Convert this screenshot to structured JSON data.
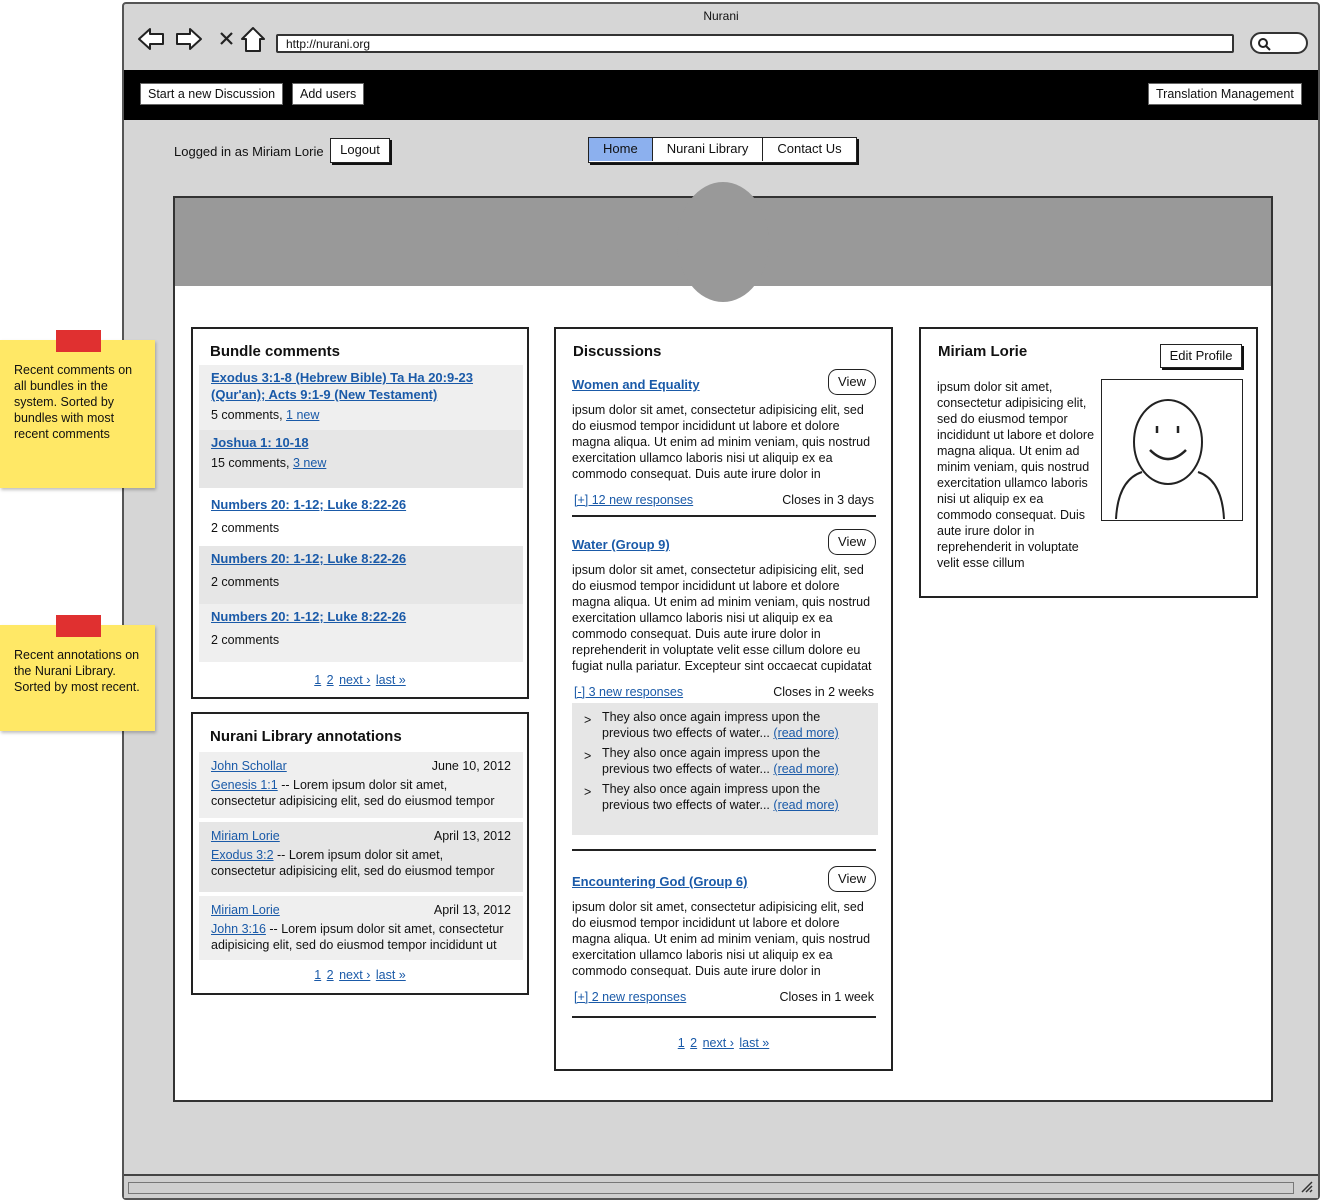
{
  "window": {
    "title": "Nurani",
    "url": "http://nurani.org"
  },
  "toolbar": {
    "start_discussion": "Start a new Discussion",
    "add_users": "Add users",
    "translation_management": "Translation Management"
  },
  "session": {
    "logged_in_text": "Logged in as Miriam Lorie",
    "logout": "Logout"
  },
  "nav": {
    "tabs": [
      {
        "label": "Home",
        "active": true
      },
      {
        "label": "Nurani Library",
        "active": false
      },
      {
        "label": "Contact Us",
        "active": false
      }
    ]
  },
  "bundle_comments": {
    "title": "Bundle comments",
    "items": [
      {
        "title": "Exodus 3:1-8 (Hebrew Bible) Ta Ha 20:9-23 (Qur'an); Acts 9:1-9 (New Testament)",
        "meta": "5 comments, ",
        "new": "1 new"
      },
      {
        "title": "Joshua 1: 10-18",
        "meta": "15 comments, ",
        "new": "3 new"
      },
      {
        "title": "Numbers 20: 1-12; Luke 8:22-26",
        "meta": "2 comments",
        "new": ""
      },
      {
        "title": "Numbers 20: 1-12; Luke 8:22-26",
        "meta": "2 comments",
        "new": ""
      },
      {
        "title": "Numbers 20: 1-12; Luke 8:22-26",
        "meta": "2 comments",
        "new": ""
      }
    ],
    "pager": {
      "p1": "1",
      "p2": "2",
      "next": "next ›",
      "last": "last »"
    }
  },
  "annotations": {
    "title": "Nurani Library annotations",
    "items": [
      {
        "user": "John Schollar",
        "date": "June 10, 2012",
        "ref": "Genesis 1:1",
        "text": " -- Lorem ipsum dolor sit amet, consectetur adipisicing elit, sed do eiusmod tempor"
      },
      {
        "user": "Miriam Lorie",
        "date": "April 13, 2012",
        "ref": "Exodus 3:2",
        "text": " -- Lorem ipsum dolor sit amet, consectetur adipisicing elit, sed do eiusmod tempor"
      },
      {
        "user": "Miriam Lorie",
        "date": "April 13, 2012",
        "ref": "John 3:16",
        "text": " -- Lorem ipsum dolor sit amet, consectetur adipisicing elit, sed do eiusmod tempor incididunt ut"
      }
    ],
    "pager": {
      "p1": "1",
      "p2": "2",
      "next": "next ›",
      "last": "last »"
    }
  },
  "discussions": {
    "title": "Discussions",
    "view_label": "View",
    "items": [
      {
        "title": "Women and Equality",
        "body": "ipsum dolor sit amet, consectetur adipisicing elit, sed do eiusmod tempor incididunt ut labore et dolore magna aliqua. Ut enim ad minim veniam, quis nostrud exercitation ullamco laboris nisi ut aliquip ex ea commodo consequat. Duis aute irure dolor in",
        "responses": "[+] 12 new responses",
        "closes": "Closes in 3 days"
      },
      {
        "title": "Water (Group 9)",
        "body": "ipsum dolor sit amet, consectetur adipisicing elit, sed do eiusmod tempor incididunt ut labore et dolore magna aliqua. Ut enim ad minim veniam, quis nostrud exercitation ullamco laboris nisi ut aliquip ex ea commodo consequat. Duis aute irure dolor in reprehenderit in voluptate velit esse cillum dolore eu fugiat nulla pariatur. Excepteur sint occaecat cupidatat",
        "responses": "[-] 3 new responses",
        "closes": "Closes in 2 weeks",
        "response_items": [
          {
            "text": "They also once again impress upon the previous two effects of water...",
            "more": "(read more)"
          },
          {
            "text": "They also once again impress upon the previous two effects of water...",
            "more": "(read more)"
          },
          {
            "text": "They also once again impress upon the previous two effects of water...",
            "more": "(read more)"
          }
        ]
      },
      {
        "title": "Encountering God (Group 6)",
        "body": "ipsum dolor sit amet, consectetur adipisicing elit, sed do eiusmod tempor incididunt ut labore et dolore magna aliqua. Ut enim ad minim veniam, quis nostrud exercitation ullamco laboris nisi ut aliquip ex ea commodo consequat. Duis aute irure dolor in",
        "responses": "[+] 2 new responses",
        "closes": "Closes in 1 week"
      }
    ],
    "pager": {
      "p1": "1",
      "p2": "2",
      "next": "next ›",
      "last": "last »"
    }
  },
  "profile": {
    "name": "Miriam Lorie",
    "edit": "Edit Profile",
    "bio": "ipsum dolor sit amet, consectetur adipisicing elit, sed do eiusmod tempor incididunt ut labore et dolore magna aliqua. Ut enim ad minim veniam, quis nostrud exercitation ullamco laboris nisi ut aliquip ex ea commodo consequat. Duis aute irure dolor in reprehenderit in voluptate velit esse cillum"
  },
  "notes": {
    "note1": "Recent comments on all bundles in the system.  Sorted by bundles with most recent comments",
    "note2": "Recent annotations on the Nurani Library.  Sorted by most recent."
  },
  "colors": {
    "active_tab": "#8cb0ee",
    "link": "#1a5aa8",
    "sticky": "#ffe866",
    "sticky_tab": "#e03030",
    "banner": "#999999"
  }
}
